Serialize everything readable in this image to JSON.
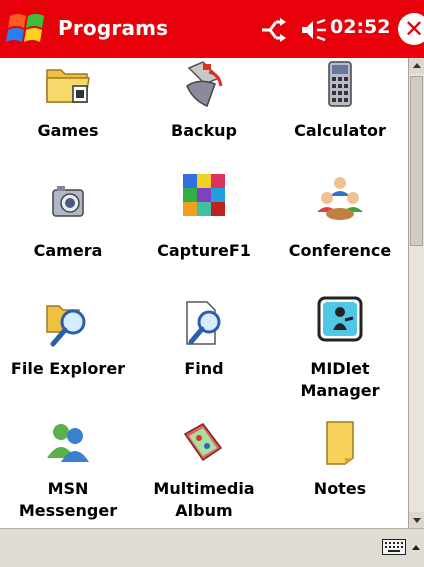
{
  "titlebar": {
    "title": "Programs",
    "time": "02:52",
    "close_glyph": "✕",
    "icons": [
      "windows-start-icon",
      "connectivity-icon",
      "volume-icon",
      "close-icon"
    ]
  },
  "programs": [
    {
      "label": "Games",
      "icon": "folder-games-icon"
    },
    {
      "label": "Backup",
      "icon": "backup-icon"
    },
    {
      "label": "Calculator",
      "icon": "calculator-icon"
    },
    {
      "label": "Camera",
      "icon": "camera-icon"
    },
    {
      "label": "CaptureF1",
      "icon": "capture-icon"
    },
    {
      "label": "Conference",
      "icon": "conference-icon"
    },
    {
      "label": "File Explorer",
      "icon": "file-explorer-icon"
    },
    {
      "label": "Find",
      "icon": "find-icon"
    },
    {
      "label": "MIDlet\nManager",
      "icon": "midlet-manager-icon"
    },
    {
      "label": "MSN\nMessenger",
      "icon": "msn-messenger-icon"
    },
    {
      "label": "Multimedia\nAlbum",
      "icon": "multimedia-album-icon"
    },
    {
      "label": "Notes",
      "icon": "notes-icon"
    }
  ],
  "bottombar": {
    "icons": [
      "keyboard-icon",
      "input-menu-arrow-icon"
    ]
  },
  "colors": {
    "titlebar": "#e8000a",
    "background": "#ffffff",
    "bottombar": "#e0dcd4"
  }
}
